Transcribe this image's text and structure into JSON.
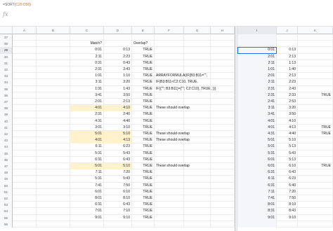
{
  "formula": {
    "prefix": "=SORT(",
    "ref": "C29:D56",
    "suffix": ")"
  },
  "fx": "fx",
  "columns": [
    "A",
    "B",
    "C",
    "D",
    "E",
    "F",
    "G",
    "H",
    "I",
    "J",
    "K"
  ],
  "rows": [
    {
      "n": "37"
    },
    {
      "n": "38",
      "C": "Match?",
      "E": "Overlap?"
    },
    {
      "n": "29",
      "C": "0:01",
      "D": "0:13",
      "E": "TRUE",
      "I": "0:01",
      "J": "0:13"
    },
    {
      "n": "30",
      "C": "2:11",
      "D": "2:23",
      "E": "TRUE",
      "I": "2:01",
      "J": "2:13"
    },
    {
      "n": "31",
      "C": "0:31",
      "D": "0:43",
      "E": "TRUE",
      "I": "2:11",
      "J": "1:13"
    },
    {
      "n": "32",
      "C": "2:31",
      "D": "2:43",
      "E": "TRUE",
      "I": "1:01",
      "J": "1:40"
    },
    {
      "n": "33",
      "C": "1:01",
      "D": "1:10",
      "E": "TRUE",
      "F": "ARRAYFORMULA(IF(B3:B11=\"\",",
      "I": "2:01",
      "J": "2:13"
    },
    {
      "n": "34",
      "C": "3:11",
      "D": "3:20",
      "E": "TRUE",
      "F": "IF(B3:B11<C2:C10, TRUE,",
      "I": "2:11",
      "J": "2:23"
    },
    {
      "n": "35",
      "C": "1:31",
      "D": "1:43",
      "E": "TRUE",
      "F": "IF({\"\"; B3:B11}={\"\"; C2:C10}, TRUE, )))",
      "I": "2:31",
      "J": "2:43"
    },
    {
      "n": "36",
      "C": "3:41",
      "D": "3:50",
      "E": "TRUE",
      "I": "2:31",
      "J": "2:33",
      "K": "TRUE"
    },
    {
      "n": "37",
      "C": "2:01",
      "D": "2:13",
      "E": "TRUE",
      "I": "2:41",
      "J": "2:53"
    },
    {
      "n": "38",
      "C": "4:01",
      "D": "4:10",
      "E": "TRUE",
      "F": "These should overlap",
      "I": "3:11",
      "J": "3:20",
      "hl": true
    },
    {
      "n": "39",
      "C": "2:31",
      "D": "2:40",
      "E": "TRUE",
      "I": "3:41",
      "J": "3:50"
    },
    {
      "n": "40",
      "C": "4:31",
      "D": "4:40",
      "E": "TRUE",
      "I": "4:01",
      "J": "4:10"
    },
    {
      "n": "41",
      "C": "3:01",
      "D": "3:10",
      "E": "TRUE",
      "I": "4:01",
      "J": "4:13",
      "K": "TRUE"
    },
    {
      "n": "42",
      "C": "5:01",
      "D": "5:10",
      "E": "TRUE",
      "F": "These should overlap",
      "I": "4:31",
      "J": "4:40",
      "K": "TRUE",
      "hl": true
    },
    {
      "n": "43",
      "C": "4:01",
      "D": "4:13",
      "E": "TRUE",
      "F": "These should overlap",
      "I": "5:01",
      "J": "5:10",
      "hl": true
    },
    {
      "n": "44",
      "C": "6:11",
      "D": "6:23",
      "E": "TRUE",
      "I": "5:01",
      "J": "5:13"
    },
    {
      "n": "45",
      "C": "5:31",
      "D": "5:43",
      "E": "TRUE",
      "I": "5:31",
      "J": "5:43"
    },
    {
      "n": "46",
      "C": "6:31",
      "D": "6:43",
      "E": "TRUE",
      "I": "6:01",
      "J": "5:13"
    },
    {
      "n": "47",
      "C": "5:01",
      "D": "5:10",
      "E": "TRUE",
      "F": "These should overlap",
      "I": "6:01",
      "J": "6:10",
      "K": "TRUE",
      "hl": true
    },
    {
      "n": "48",
      "C": "7:11",
      "D": "7:20",
      "E": "TRUE",
      "I": "6:31",
      "J": "6:43"
    },
    {
      "n": "49",
      "C": "5:31",
      "D": "5:43",
      "E": "TRUE",
      "I": "6:11",
      "J": "6:23"
    },
    {
      "n": "50",
      "C": "7:41",
      "D": "7:50",
      "E": "TRUE",
      "I": "6:31",
      "J": "6:40"
    },
    {
      "n": "51",
      "C": "6:01",
      "D": "6:10",
      "E": "TRUE",
      "I": "7:11",
      "J": "7:20"
    },
    {
      "n": "52",
      "C": "8:01",
      "D": "8:10",
      "E": "TRUE",
      "I": "7:41",
      "J": "7:50"
    },
    {
      "n": "53",
      "C": "6:31",
      "D": "6:43",
      "E": "TRUE",
      "I": "8:01",
      "J": "8:10"
    },
    {
      "n": "54",
      "C": "7:01",
      "D": "7:10",
      "E": "TRUE",
      "I": "8:31",
      "J": "8:43"
    },
    {
      "n": "55",
      "C": "9:01",
      "D": "9:10",
      "E": "TRUE",
      "I": "9:01",
      "J": "9:10"
    },
    {
      "n": "56"
    }
  ],
  "colors": {
    "highlight": "#fff2cc",
    "selection": "#1a73e8",
    "formulaRef": "#e37400"
  }
}
